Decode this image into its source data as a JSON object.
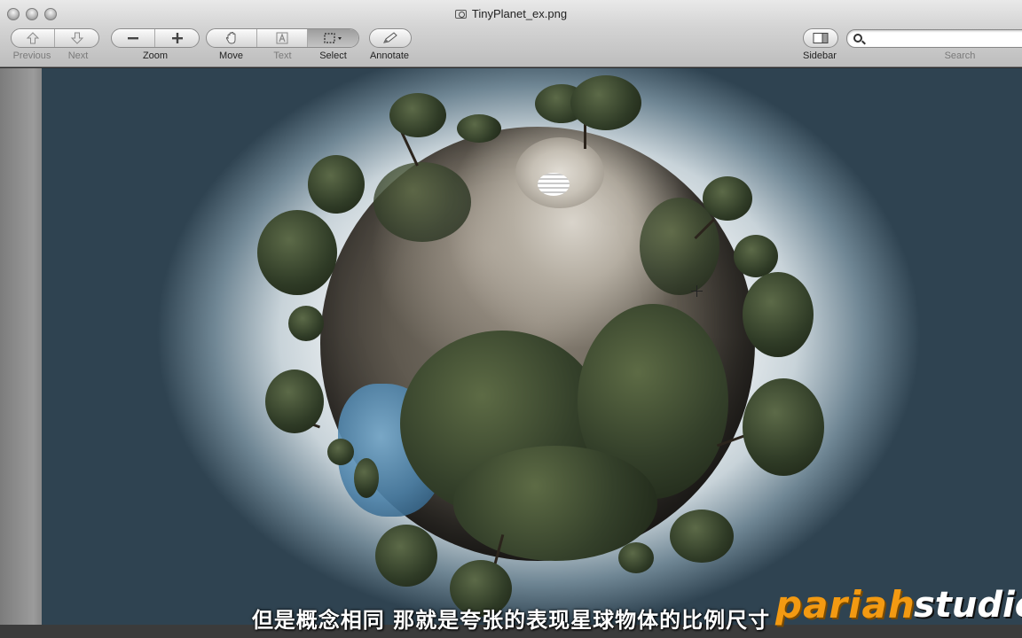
{
  "window": {
    "title": "TinyPlanet_ex.png"
  },
  "toolbar": {
    "previous_label": "Previous",
    "next_label": "Next",
    "zoom_label": "Zoom",
    "move_label": "Move",
    "text_label": "Text",
    "select_label": "Select",
    "annotate_label": "Annotate",
    "sidebar_label": "Sidebar",
    "search_label": "Search",
    "search_value": ""
  },
  "icons": {
    "previous": "up-arrow-icon",
    "next": "down-arrow-icon",
    "zoom_out": "minus-icon",
    "zoom_in": "plus-icon",
    "move": "hand-icon",
    "text": "text-tool-icon",
    "select": "marquee-select-icon",
    "annotate": "pencil-icon",
    "sidebar": "sidebar-icon",
    "search": "magnifier-icon"
  },
  "overlay": {
    "subtitle": "但是概念相同 那就是夸张的表现星球物体的比例尺寸",
    "watermark_part1": "pariah",
    "watermark_part2": "studio"
  },
  "colors": {
    "watermark_orange": "#f39a12"
  }
}
